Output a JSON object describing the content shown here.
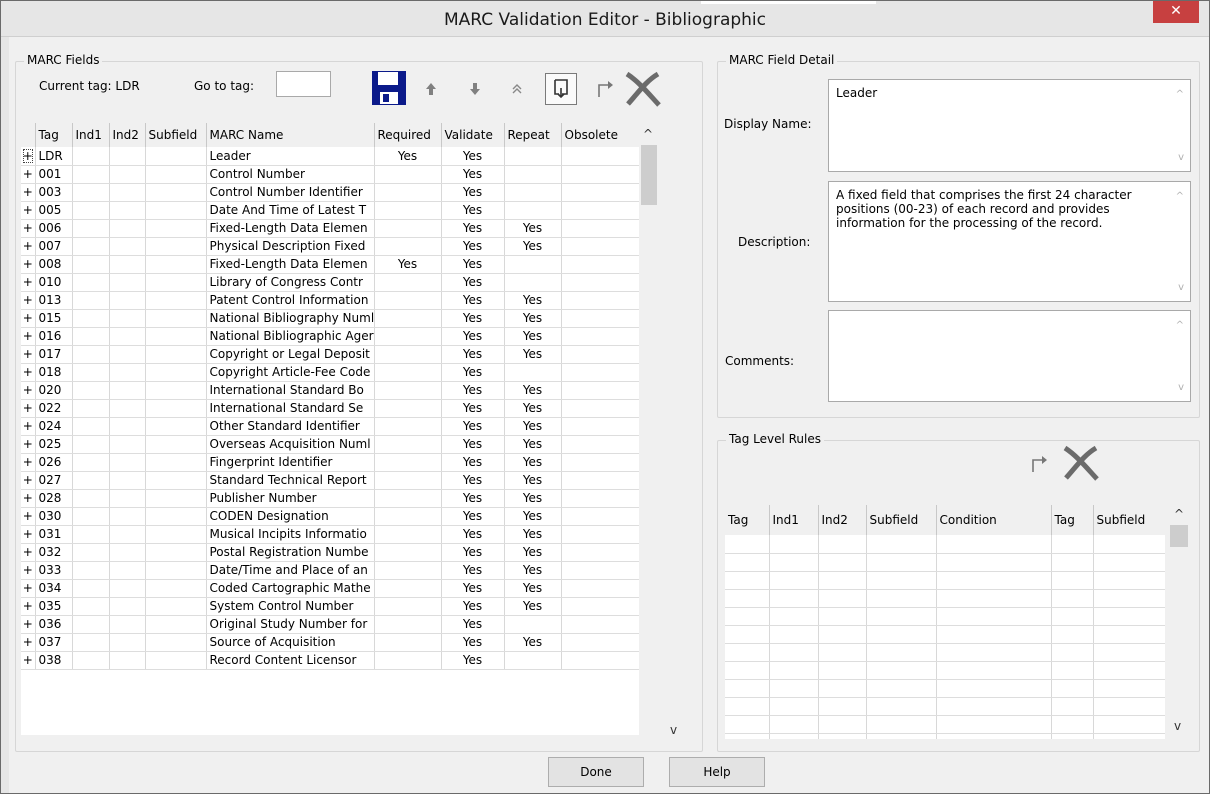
{
  "window": {
    "title": "MARC Validation Editor - Bibliographic",
    "close_glyph": "✕"
  },
  "marc_fields": {
    "group_label": "MARC Fields",
    "current_tag_label": "Current tag: LDR",
    "goto_label": "Go to tag:",
    "goto_value": "",
    "columns": [
      "",
      "Tag",
      "Ind1",
      "Ind2",
      "Subfield",
      "MARC Name",
      "Required",
      "Validate",
      "Repeat",
      "Obsolete"
    ],
    "rows": [
      {
        "expand": "+",
        "tag": "LDR",
        "ind1": "",
        "ind2": "",
        "sub": "",
        "name": "Leader",
        "req": "Yes",
        "val": "Yes",
        "rep": "",
        "obs": ""
      },
      {
        "expand": "+",
        "tag": "001",
        "ind1": "",
        "ind2": "",
        "sub": "",
        "name": "Control Number",
        "req": "",
        "val": "Yes",
        "rep": "",
        "obs": ""
      },
      {
        "expand": "+",
        "tag": "003",
        "ind1": "",
        "ind2": "",
        "sub": "",
        "name": "Control Number Identifier",
        "req": "",
        "val": "Yes",
        "rep": "",
        "obs": ""
      },
      {
        "expand": "+",
        "tag": "005",
        "ind1": "",
        "ind2": "",
        "sub": "",
        "name": "Date And Time of Latest T",
        "req": "",
        "val": "Yes",
        "rep": "",
        "obs": ""
      },
      {
        "expand": "+",
        "tag": "006",
        "ind1": "",
        "ind2": "",
        "sub": "",
        "name": "Fixed-Length Data Elemen",
        "req": "",
        "val": "Yes",
        "rep": "Yes",
        "obs": ""
      },
      {
        "expand": "+",
        "tag": "007",
        "ind1": "",
        "ind2": "",
        "sub": "",
        "name": "Physical Description Fixed",
        "req": "",
        "val": "Yes",
        "rep": "Yes",
        "obs": ""
      },
      {
        "expand": "+",
        "tag": "008",
        "ind1": "",
        "ind2": "",
        "sub": "",
        "name": "Fixed-Length Data Elemen",
        "req": "Yes",
        "val": "Yes",
        "rep": "",
        "obs": ""
      },
      {
        "expand": "+",
        "tag": "010",
        "ind1": "",
        "ind2": "",
        "sub": "",
        "name": "Library of Congress Contr",
        "req": "",
        "val": "Yes",
        "rep": "",
        "obs": ""
      },
      {
        "expand": "+",
        "tag": "013",
        "ind1": "",
        "ind2": "",
        "sub": "",
        "name": "Patent Control Information",
        "req": "",
        "val": "Yes",
        "rep": "Yes",
        "obs": ""
      },
      {
        "expand": "+",
        "tag": "015",
        "ind1": "",
        "ind2": "",
        "sub": "",
        "name": "National Bibliography Numl",
        "req": "",
        "val": "Yes",
        "rep": "Yes",
        "obs": ""
      },
      {
        "expand": "+",
        "tag": "016",
        "ind1": "",
        "ind2": "",
        "sub": "",
        "name": "National Bibliographic Ager",
        "req": "",
        "val": "Yes",
        "rep": "Yes",
        "obs": ""
      },
      {
        "expand": "+",
        "tag": "017",
        "ind1": "",
        "ind2": "",
        "sub": "",
        "name": "Copyright or Legal Deposit",
        "req": "",
        "val": "Yes",
        "rep": "Yes",
        "obs": ""
      },
      {
        "expand": "+",
        "tag": "018",
        "ind1": "",
        "ind2": "",
        "sub": "",
        "name": "Copyright Article-Fee Code",
        "req": "",
        "val": "Yes",
        "rep": "",
        "obs": ""
      },
      {
        "expand": "+",
        "tag": "020",
        "ind1": "",
        "ind2": "",
        "sub": "",
        "name": "International Standard Bo",
        "req": "",
        "val": "Yes",
        "rep": "Yes",
        "obs": ""
      },
      {
        "expand": "+",
        "tag": "022",
        "ind1": "",
        "ind2": "",
        "sub": "",
        "name": "International Standard Se",
        "req": "",
        "val": "Yes",
        "rep": "Yes",
        "obs": ""
      },
      {
        "expand": "+",
        "tag": "024",
        "ind1": "",
        "ind2": "",
        "sub": "",
        "name": "Other Standard Identifier",
        "req": "",
        "val": "Yes",
        "rep": "Yes",
        "obs": ""
      },
      {
        "expand": "+",
        "tag": "025",
        "ind1": "",
        "ind2": "",
        "sub": "",
        "name": "Overseas Acquisition Numl",
        "req": "",
        "val": "Yes",
        "rep": "Yes",
        "obs": ""
      },
      {
        "expand": "+",
        "tag": "026",
        "ind1": "",
        "ind2": "",
        "sub": "",
        "name": "Fingerprint Identifier",
        "req": "",
        "val": "Yes",
        "rep": "Yes",
        "obs": ""
      },
      {
        "expand": "+",
        "tag": "027",
        "ind1": "",
        "ind2": "",
        "sub": "",
        "name": "Standard Technical Report",
        "req": "",
        "val": "Yes",
        "rep": "Yes",
        "obs": ""
      },
      {
        "expand": "+",
        "tag": "028",
        "ind1": "",
        "ind2": "",
        "sub": "",
        "name": "Publisher Number",
        "req": "",
        "val": "Yes",
        "rep": "Yes",
        "obs": ""
      },
      {
        "expand": "+",
        "tag": "030",
        "ind1": "",
        "ind2": "",
        "sub": "",
        "name": "CODEN Designation",
        "req": "",
        "val": "Yes",
        "rep": "Yes",
        "obs": ""
      },
      {
        "expand": "+",
        "tag": "031",
        "ind1": "",
        "ind2": "",
        "sub": "",
        "name": "Musical Incipits Informatio",
        "req": "",
        "val": "Yes",
        "rep": "Yes",
        "obs": ""
      },
      {
        "expand": "+",
        "tag": "032",
        "ind1": "",
        "ind2": "",
        "sub": "",
        "name": "Postal Registration Numbe",
        "req": "",
        "val": "Yes",
        "rep": "Yes",
        "obs": ""
      },
      {
        "expand": "+",
        "tag": "033",
        "ind1": "",
        "ind2": "",
        "sub": "",
        "name": "Date/Time and Place of an",
        "req": "",
        "val": "Yes",
        "rep": "Yes",
        "obs": ""
      },
      {
        "expand": "+",
        "tag": "034",
        "ind1": "",
        "ind2": "",
        "sub": "",
        "name": "Coded Cartographic Mathe",
        "req": "",
        "val": "Yes",
        "rep": "Yes",
        "obs": ""
      },
      {
        "expand": "+",
        "tag": "035",
        "ind1": "",
        "ind2": "",
        "sub": "",
        "name": "System Control Number",
        "req": "",
        "val": "Yes",
        "rep": "Yes",
        "obs": ""
      },
      {
        "expand": "+",
        "tag": "036",
        "ind1": "",
        "ind2": "",
        "sub": "",
        "name": "Original Study Number for",
        "req": "",
        "val": "Yes",
        "rep": "",
        "obs": ""
      },
      {
        "expand": "+",
        "tag": "037",
        "ind1": "",
        "ind2": "",
        "sub": "",
        "name": "Source of Acquisition",
        "req": "",
        "val": "Yes",
        "rep": "Yes",
        "obs": ""
      },
      {
        "expand": "+",
        "tag": "038",
        "ind1": "",
        "ind2": "",
        "sub": "",
        "name": "Record Content Licensor",
        "req": "",
        "val": "Yes",
        "rep": "",
        "obs": ""
      }
    ],
    "scroll_up": "^",
    "scroll_down": "v"
  },
  "field_detail": {
    "group_label": "MARC Field Detail",
    "display_name_label": "Display Name:",
    "display_name_value": "Leader",
    "description_label": "Description:",
    "description_value": "A fixed field that comprises the first 24 character positions (00-23) of each record and provides information for the processing of the record.",
    "comments_label": "Comments:",
    "comments_value": ""
  },
  "tag_rules": {
    "group_label": "Tag Level Rules",
    "columns": [
      "Tag",
      "Ind1",
      "Ind2",
      "Subfield",
      "Condition",
      "Tag",
      "Subfield"
    ],
    "empty_rows": 12
  },
  "footer": {
    "done_label": "Done",
    "help_label": "Help"
  }
}
